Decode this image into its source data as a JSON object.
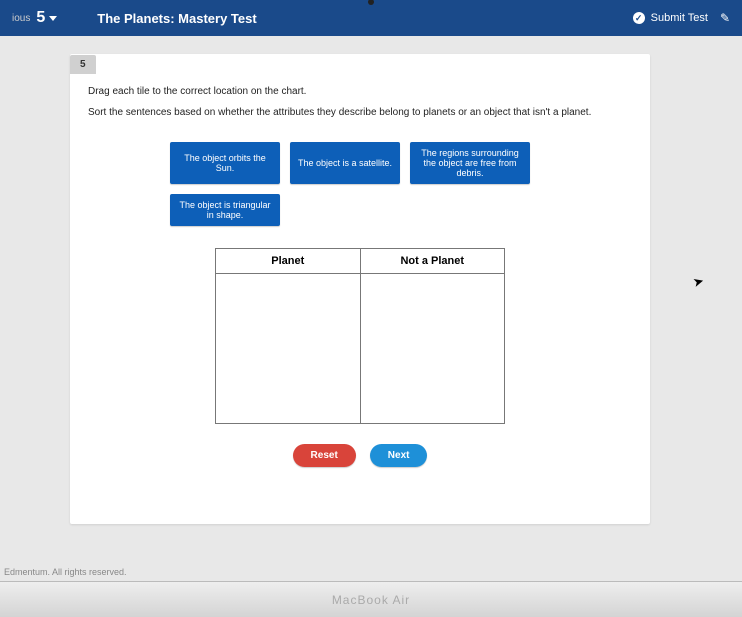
{
  "header": {
    "nav_label": "ious",
    "question_number": "5",
    "title": "The Planets: Mastery Test",
    "submit_label": "Submit Test"
  },
  "question": {
    "tab_number": "5",
    "instruction_line1": "Drag each tile to the correct location on the chart.",
    "instruction_line2": "Sort the sentences based on whether the attributes they describe belong to planets or an object that isn't a planet."
  },
  "tiles": [
    "The object orbits the Sun.",
    "The object is a satellite.",
    "The regions surrounding the object are free from debris.",
    "The object is triangular in shape."
  ],
  "chart": {
    "col1": "Planet",
    "col2": "Not a Planet"
  },
  "buttons": {
    "reset": "Reset",
    "next": "Next"
  },
  "footer": "Edmentum. All rights reserved.",
  "device": "MacBook Air"
}
